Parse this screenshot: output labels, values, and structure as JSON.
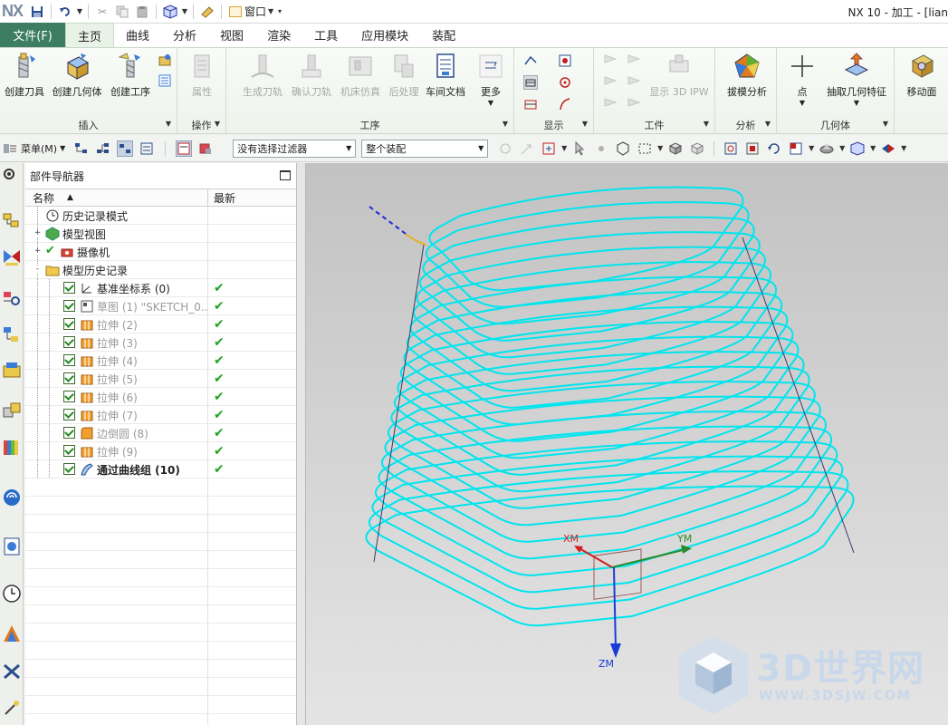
{
  "titlebar": {
    "logo": "NX",
    "window_menu": "窗口",
    "app_title": "NX 10 - 加工 - [lian"
  },
  "tabs": {
    "file": "文件(F)",
    "items": [
      "主页",
      "曲线",
      "分析",
      "视图",
      "渲染",
      "工具",
      "应用模块",
      "装配"
    ],
    "active": "主页"
  },
  "ribbon": {
    "insert": {
      "label": "插入",
      "buttons": [
        "创建刀具",
        "创建几何体",
        "创建工序"
      ]
    },
    "operation": {
      "label": "操作",
      "buttons": [
        "属性"
      ]
    },
    "process": {
      "label": "工序",
      "buttons": [
        "生成刀轨",
        "确认刀轨",
        "机床仿真",
        "后处理",
        "车间文档",
        "更多"
      ]
    },
    "display": {
      "label": "显示"
    },
    "workpiece": {
      "label": "工件",
      "buttons": [
        "显示 3D IPW"
      ]
    },
    "analysis": {
      "label": "分析",
      "buttons": [
        "拔模分析"
      ]
    },
    "geometry": {
      "label": "几何体",
      "buttons": [
        "点",
        "抽取几何特征"
      ]
    },
    "move": {
      "buttons": [
        "移动面"
      ]
    }
  },
  "toolbar2": {
    "menu_label": "菜单(M)",
    "filter_select": "没有选择过滤器",
    "assembly_select": "整个装配"
  },
  "navigator": {
    "title": "部件导航器",
    "columns": [
      "名称",
      "最新"
    ],
    "rows": [
      {
        "label": "历史记录模式",
        "level": 0,
        "expander": "",
        "check": false,
        "latest": false,
        "style": "normal"
      },
      {
        "label": "模型视图",
        "level": 0,
        "expander": "+",
        "check": false,
        "latest": false,
        "style": "normal"
      },
      {
        "label": "摄像机",
        "level": 0,
        "expander": "+",
        "check": false,
        "latest": false,
        "style": "normal"
      },
      {
        "label": "模型历史记录",
        "level": 0,
        "expander": "-",
        "check": false,
        "latest": false,
        "style": "normal"
      },
      {
        "label": "基准坐标系 (0)",
        "level": 1,
        "expander": "",
        "check": true,
        "latest": true,
        "style": "normal"
      },
      {
        "label": "草图 (1) \"SKETCH_0...",
        "level": 1,
        "expander": "",
        "check": true,
        "latest": true,
        "style": "gray"
      },
      {
        "label": "拉伸 (2)",
        "level": 1,
        "expander": "",
        "check": true,
        "latest": true,
        "style": "gray"
      },
      {
        "label": "拉伸 (3)",
        "level": 1,
        "expander": "",
        "check": true,
        "latest": true,
        "style": "gray"
      },
      {
        "label": "拉伸 (4)",
        "level": 1,
        "expander": "",
        "check": true,
        "latest": true,
        "style": "gray"
      },
      {
        "label": "拉伸 (5)",
        "level": 1,
        "expander": "",
        "check": true,
        "latest": true,
        "style": "gray"
      },
      {
        "label": "拉伸 (6)",
        "level": 1,
        "expander": "",
        "check": true,
        "latest": true,
        "style": "gray"
      },
      {
        "label": "拉伸 (7)",
        "level": 1,
        "expander": "",
        "check": true,
        "latest": true,
        "style": "gray"
      },
      {
        "label": "边倒圆 (8)",
        "level": 1,
        "expander": "",
        "check": true,
        "latest": true,
        "style": "gray"
      },
      {
        "label": "拉伸 (9)",
        "level": 1,
        "expander": "",
        "check": true,
        "latest": true,
        "style": "gray"
      },
      {
        "label": "通过曲线组 (10)",
        "level": 1,
        "expander": "",
        "check": true,
        "latest": true,
        "style": "bold"
      }
    ]
  },
  "viewport": {
    "axes": {
      "x": "XM",
      "y": "YM",
      "z": "ZM"
    },
    "toolpath_color": "#00e5ee"
  },
  "watermark": {
    "text": "3D世界网",
    "url": "WWW.3DSJW.COM"
  },
  "colors": {
    "file_tab": "#3d7d62",
    "check_green": "#22a322"
  }
}
